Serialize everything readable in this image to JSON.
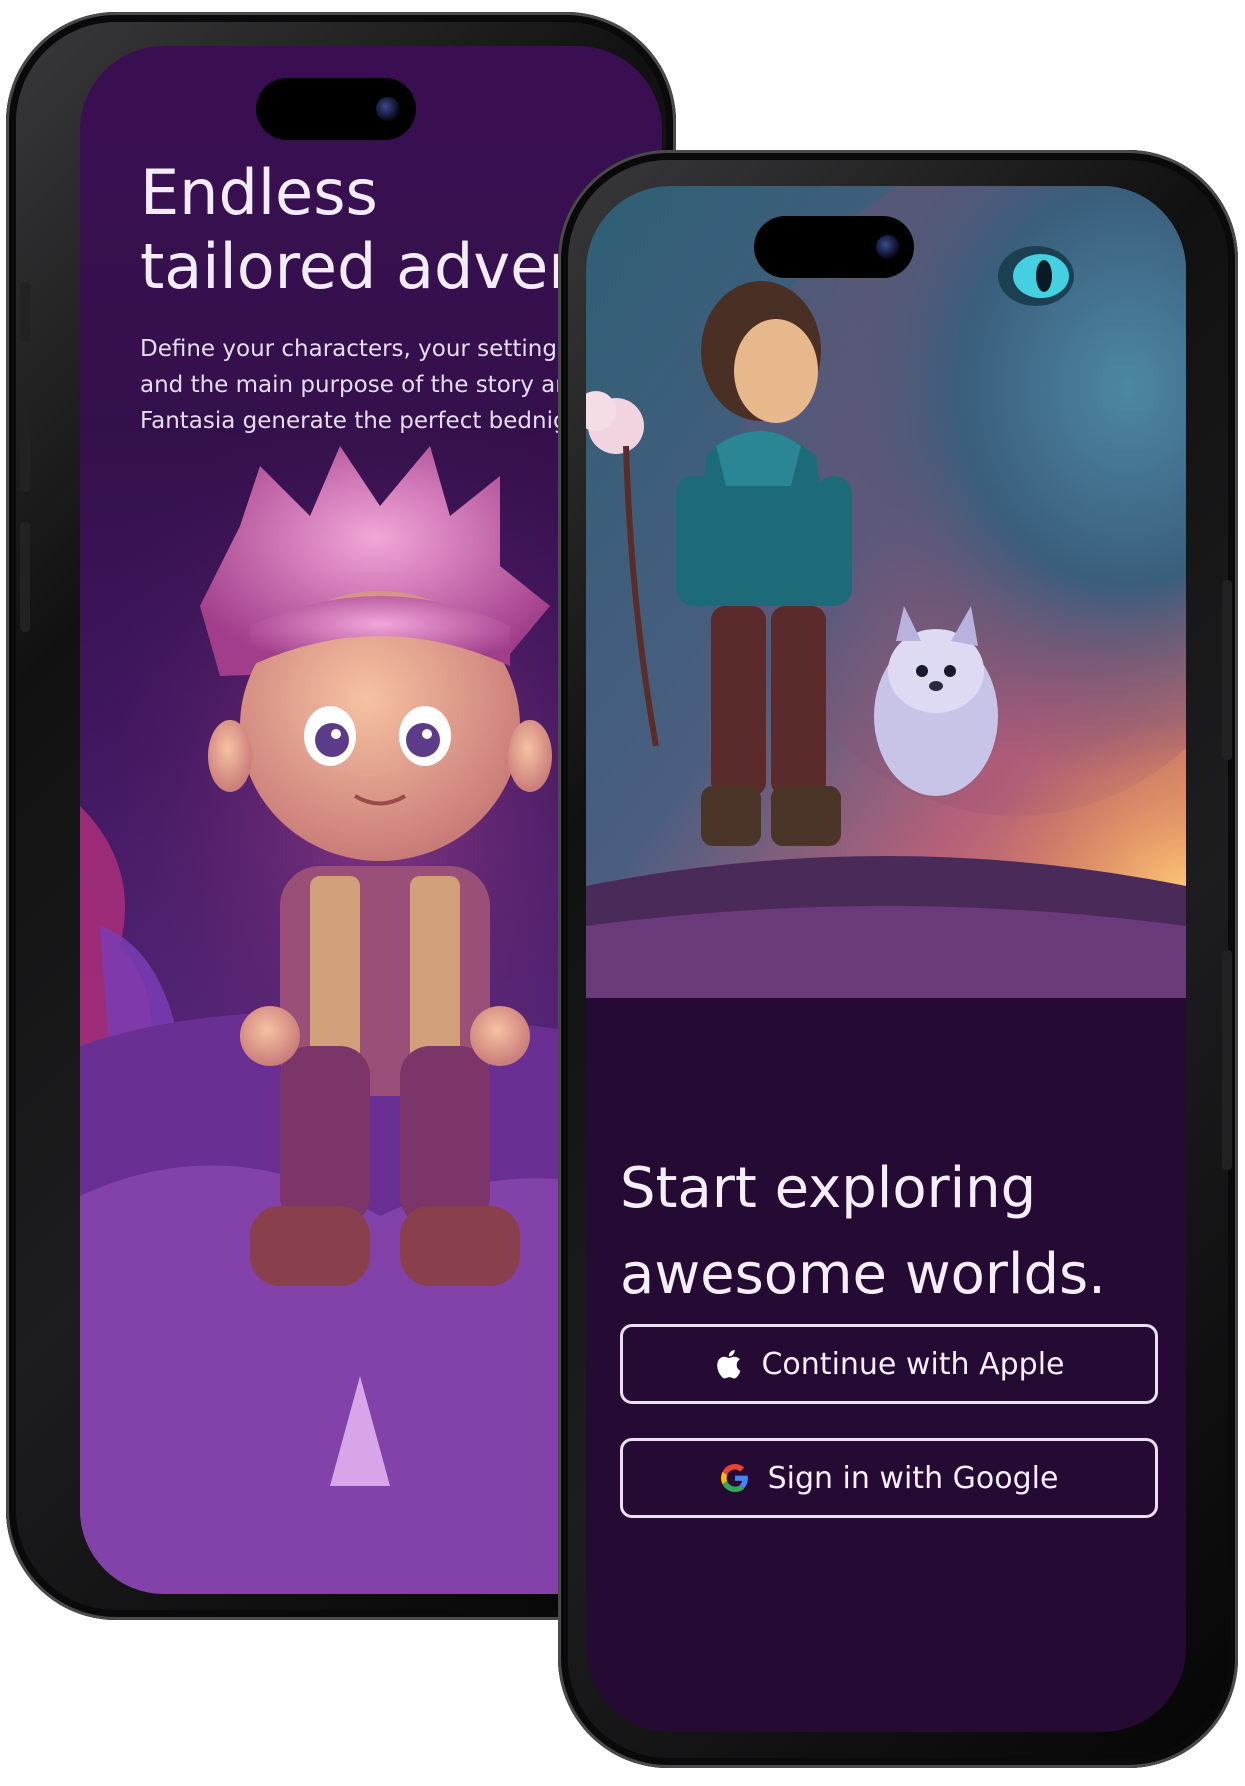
{
  "onboarding": {
    "title_line1": "Endless",
    "title_line2": "tailored adventures",
    "description_line1": "Define your characters, your settings",
    "description_line2": "and the main purpose of the story and / or let",
    "description_line3": "Fantasia generate the perfect bednight story."
  },
  "signin": {
    "title_line1": "Start exploring",
    "title_line2": "awesome worlds.",
    "apple_label": "Continue with Apple",
    "apple_icon": "apple-icon",
    "google_label": "Sign in with Google",
    "google_icon": "google-icon"
  },
  "colors": {
    "panel_background": "#250a34",
    "text": "#f6eefc",
    "button_border": "#e9e1f0",
    "google_blue": "#4285F4",
    "google_red": "#EA4335",
    "google_yellow": "#FBBC05",
    "google_green": "#34A853"
  }
}
